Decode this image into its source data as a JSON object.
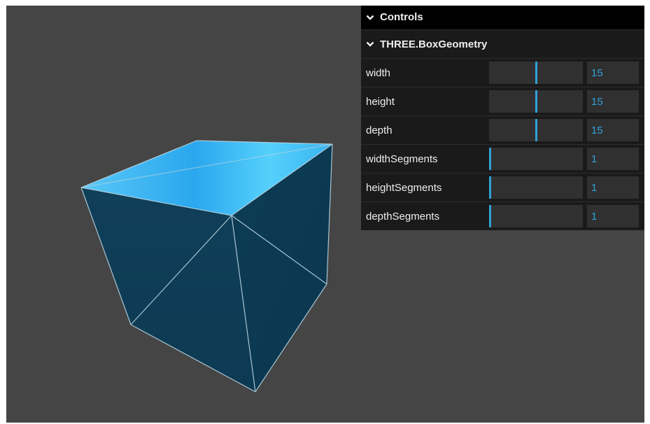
{
  "gui": {
    "title": "Controls",
    "folder": {
      "title": "THREE.BoxGeometry",
      "params": [
        {
          "label": "width",
          "value": "15",
          "fraction": 0.5
        },
        {
          "label": "height",
          "value": "15",
          "fraction": 0.5
        },
        {
          "label": "depth",
          "value": "15",
          "fraction": 0.5
        },
        {
          "label": "widthSegments",
          "value": "1",
          "fraction": 0.0
        },
        {
          "label": "heightSegments",
          "value": "1",
          "fraction": 0.0
        },
        {
          "label": "depthSegments",
          "value": "1",
          "fraction": 0.0
        }
      ]
    }
  },
  "colors": {
    "viewport_bg": "#454545",
    "accent": "#2fa1d6",
    "cube_side": "#0d3c55",
    "cube_top": "#3cbcf5",
    "edges": "#b8d4e0"
  },
  "icons": {
    "collapse": "chevron-down-icon"
  }
}
